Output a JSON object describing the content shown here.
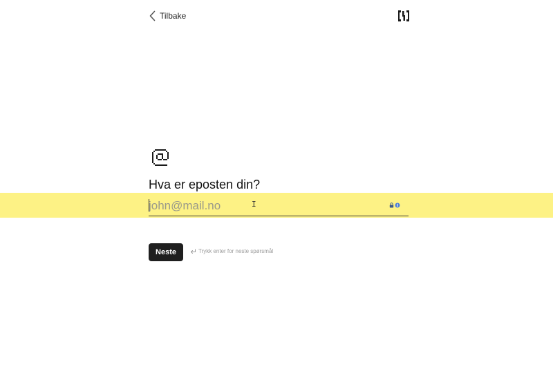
{
  "header": {
    "back_label": "Tilbake",
    "back_icon": "chevron-left-icon",
    "logo_icon": "brand-logo-icon"
  },
  "question": {
    "icon": "at-sign-icon",
    "title": "Hva er eposten din?"
  },
  "email": {
    "value": "",
    "placeholder": "john@mail.no",
    "highlight_color": "#fdf285",
    "password_manager_icon": "password-manager-icon"
  },
  "actions": {
    "next_label": "Neste",
    "hint_icon": "enter-key-icon",
    "hint_text": "Trykk enter for neste spørsmål"
  }
}
